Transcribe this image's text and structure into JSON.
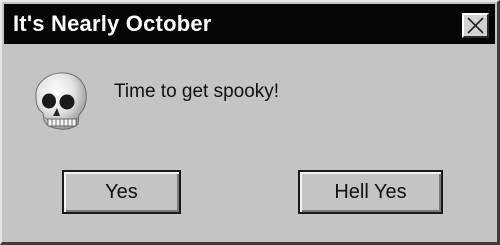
{
  "window": {
    "title": "It's Nearly October"
  },
  "dialog": {
    "icon": "skull-icon",
    "message": "Time to get spooky!"
  },
  "buttons": {
    "yes_label": "Yes",
    "hell_yes_label": "Hell Yes"
  },
  "colors": {
    "titlebar": "#050505",
    "dialog_background": "#c4c4c4",
    "title_text": "#ffffff"
  }
}
